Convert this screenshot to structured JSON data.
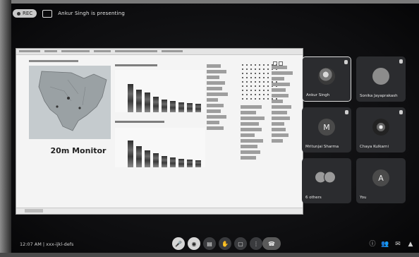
{
  "meeting": {
    "recording_label": "REC",
    "presenting_text": "Ankur Singh is presenting"
  },
  "shared_screen": {
    "monitor_label": "20m Monitor"
  },
  "participants": [
    {
      "name": "Ankur Singh",
      "avatar": "photo",
      "active": true
    },
    {
      "name": "Sonika Jayaprakash",
      "avatar": "photo-grey",
      "active": false
    },
    {
      "name": "Mritunjai Sharma",
      "avatar": "letter",
      "letter": "M",
      "active": false
    },
    {
      "name": "Chaya Kulkarni",
      "avatar": "logo",
      "active": false
    },
    {
      "name": "6 others",
      "avatar": "group",
      "active": false
    },
    {
      "name": "You",
      "avatar": "letter",
      "letter": "A",
      "active": false
    }
  ],
  "bottom_bar": {
    "clock": "12:07 AM | xxx-ijkl-defs",
    "controls": [
      {
        "icon": "mic-icon",
        "glyph": "🎤"
      },
      {
        "icon": "camera-icon",
        "glyph": "◉"
      },
      {
        "icon": "captions-icon",
        "glyph": "▤"
      },
      {
        "icon": "hand-icon",
        "glyph": "✋"
      },
      {
        "icon": "present-icon",
        "glyph": "▢"
      },
      {
        "icon": "more-icon",
        "glyph": "⋮"
      },
      {
        "icon": "end-call-icon",
        "glyph": "☎"
      }
    ],
    "right_controls": [
      {
        "icon": "info-icon",
        "glyph": "ⓘ"
      },
      {
        "icon": "people-icon",
        "glyph": "👥"
      },
      {
        "icon": "chat-icon",
        "glyph": "✉"
      },
      {
        "icon": "activities-icon",
        "glyph": "▲"
      }
    ]
  },
  "colors": {
    "background": "#0d0d0f",
    "tile": "#2b2c2f",
    "shared_bg": "#f4f4f4"
  }
}
